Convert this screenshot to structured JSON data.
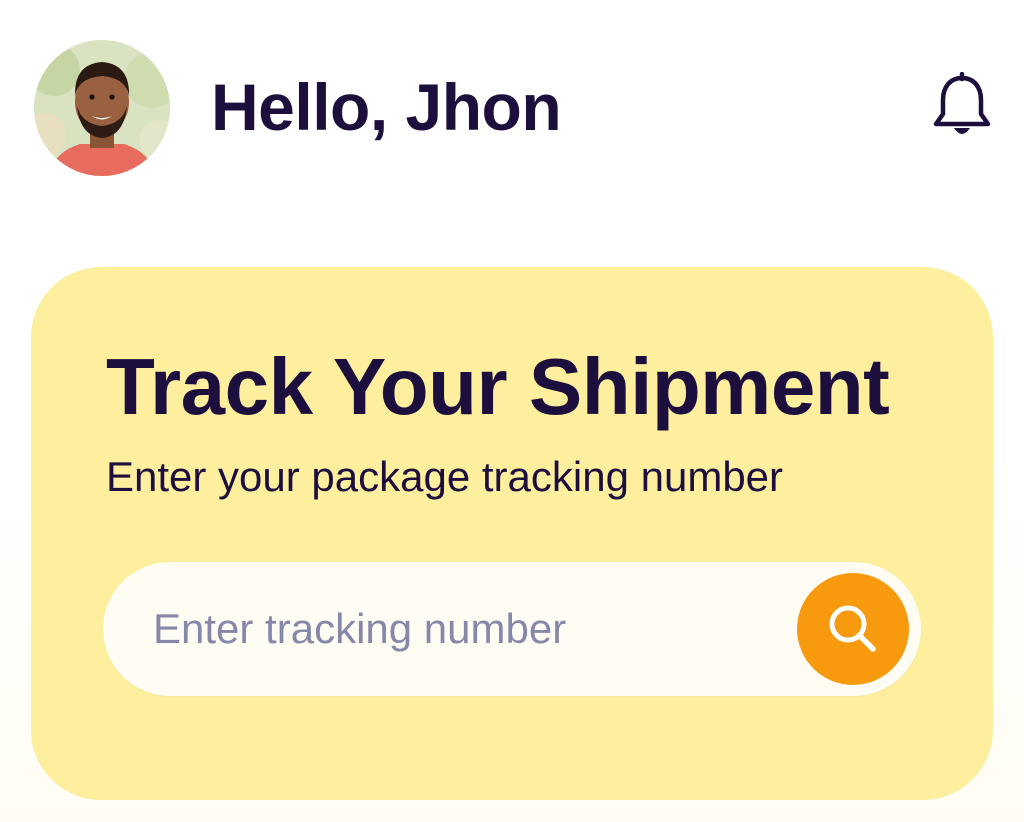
{
  "header": {
    "greeting": "Hello, Jhon",
    "avatar_icon": "user-avatar",
    "notification_icon": "bell-icon"
  },
  "tracking_card": {
    "title": "Track Your Shipment",
    "subtitle": "Enter your package tracking number",
    "search": {
      "placeholder": "Enter tracking number",
      "value": "",
      "button_icon": "search-icon"
    }
  },
  "colors": {
    "text_primary": "#1d0f3d",
    "card_background": "#fdef9d",
    "accent": "#f79a0e",
    "placeholder": "#8688aa",
    "input_background": "#fffdf3"
  }
}
